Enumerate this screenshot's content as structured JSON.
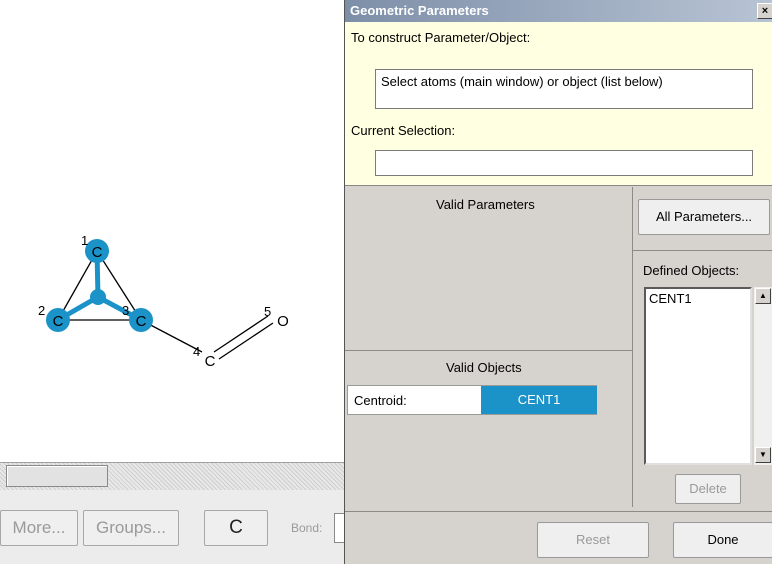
{
  "molecule": {
    "atoms": [
      {
        "element": "C",
        "number": "1"
      },
      {
        "element": "C",
        "number": "2"
      },
      {
        "element": "C",
        "number": "3"
      },
      {
        "element": "C",
        "number": "4"
      },
      {
        "element": "O",
        "number": "5"
      }
    ],
    "highlight_color": "#1b92c8"
  },
  "main_toolbar": {
    "more_label": "More...",
    "groups_label": "Groups...",
    "element_label": "C",
    "bond_label": "Bond:"
  },
  "dialog": {
    "title": "Geometric Parameters",
    "close_glyph": "×",
    "construct_label": "To construct Parameter/Object:",
    "construct_hint": "Select atoms (main window) or object (list below)",
    "current_selection_label": "Current Selection:",
    "current_selection_value": "",
    "valid_parameters_label": "Valid Parameters",
    "all_parameters_label": "All Parameters...",
    "defined_objects_label": "Defined Objects:",
    "defined_objects": [
      "CENT1"
    ],
    "valid_objects_label": "Valid Objects",
    "valid_object": {
      "name": "Centroid:",
      "value": "CENT1"
    },
    "delete_label": "Delete",
    "reset_label": "Reset",
    "done_label": "Done"
  }
}
